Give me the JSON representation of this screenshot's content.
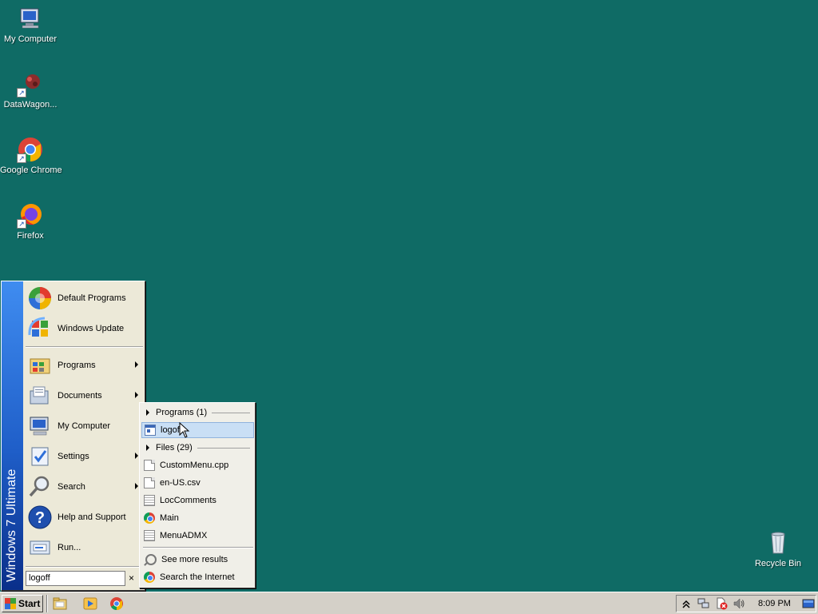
{
  "desktop": {
    "icons": [
      {
        "label": "My Computer",
        "icon": "my-computer-icon"
      },
      {
        "label": "DataWagon...",
        "icon": "datawagon-icon"
      },
      {
        "label": "Google Chrome",
        "icon": "chrome-icon"
      },
      {
        "label": "Firefox",
        "icon": "firefox-icon"
      },
      {
        "label": "Recycle Bin",
        "icon": "recycle-bin-icon"
      }
    ]
  },
  "start_menu": {
    "banner": "Windows 7 Ultimate",
    "top_items": [
      {
        "label": "Default Programs",
        "icon": "default-programs-icon"
      },
      {
        "label": "Windows Update",
        "icon": "windows-update-icon"
      }
    ],
    "items": [
      {
        "label": "Programs",
        "icon": "programs-icon",
        "submenu": true
      },
      {
        "label": "Documents",
        "icon": "documents-icon",
        "submenu": true
      },
      {
        "label": "My Computer",
        "icon": "computer-icon",
        "submenu": false
      },
      {
        "label": "Settings",
        "icon": "settings-icon",
        "submenu": true
      },
      {
        "label": "Search",
        "icon": "search-icon",
        "submenu": true
      },
      {
        "label": "Help and Support",
        "icon": "help-icon",
        "submenu": false
      },
      {
        "label": "Run...",
        "icon": "run-icon",
        "submenu": false
      }
    ],
    "search_value": "logoff",
    "clear_glyph": "×"
  },
  "search_results": {
    "programs_header": "Programs (1)",
    "program_items": [
      {
        "label": "logoff",
        "icon": "app-icon",
        "highlighted": true
      }
    ],
    "files_header": "Files (29)",
    "file_items": [
      {
        "label": "CustomMenu.cpp",
        "icon": "document-icon"
      },
      {
        "label": "en-US.csv",
        "icon": "document-icon"
      },
      {
        "label": "LocComments",
        "icon": "text-document-icon"
      },
      {
        "label": "Main",
        "icon": "chrome-icon"
      },
      {
        "label": "MenuADMX",
        "icon": "text-document-icon"
      }
    ],
    "see_more": "See more results",
    "search_internet": "Search the Internet"
  },
  "taskbar": {
    "start_label": "Start",
    "quick_launch": [
      "explorer-icon",
      "media-player-icon",
      "chrome-icon"
    ],
    "tray_icons": [
      "show-hidden-icon",
      "network-icon",
      "security-alert-icon",
      "volume-icon"
    ],
    "clock": "8:09 PM"
  }
}
